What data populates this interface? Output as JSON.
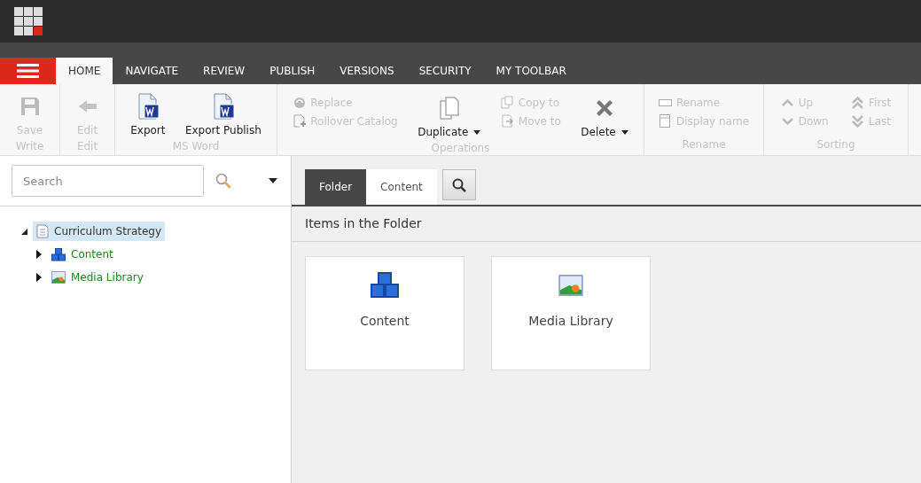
{
  "tabs": [
    {
      "label": "HOME",
      "selected": true
    },
    {
      "label": "NAVIGATE",
      "selected": false
    },
    {
      "label": "REVIEW",
      "selected": false
    },
    {
      "label": "PUBLISH",
      "selected": false
    },
    {
      "label": "VERSIONS",
      "selected": false
    },
    {
      "label": "SECURITY",
      "selected": false
    },
    {
      "label": "MY TOOLBAR",
      "selected": false
    }
  ],
  "ribbon": [
    {
      "label": "Write",
      "columns": [
        {
          "kind": "large",
          "label": "Save",
          "disabled": true
        }
      ]
    },
    {
      "label": "Edit",
      "columns": [
        {
          "kind": "large",
          "label": "Edit",
          "disabled": true
        }
      ]
    },
    {
      "label": "MS Word",
      "columns": [
        {
          "kind": "large",
          "label": "Export",
          "disabled": false
        },
        {
          "kind": "large",
          "label": "Export Publish",
          "disabled": false
        }
      ]
    },
    {
      "label": "Operations",
      "columns": [
        {
          "kind": "stack",
          "items": [
            {
              "label": "Replace",
              "disabled": true
            },
            {
              "label": "Rollover Catalog",
              "disabled": true
            }
          ]
        },
        {
          "kind": "large",
          "label": "Duplicate",
          "disabled": false,
          "dropdown": true
        },
        {
          "kind": "stack",
          "items": [
            {
              "label": "Copy to",
              "disabled": true
            },
            {
              "label": "Move to",
              "disabled": true
            }
          ]
        },
        {
          "kind": "large",
          "label": "Delete",
          "disabled": false,
          "dropdown": true
        }
      ]
    },
    {
      "label": "Rename",
      "columns": [
        {
          "kind": "stack",
          "items": [
            {
              "label": "Rename",
              "disabled": true
            },
            {
              "label": "Display name",
              "disabled": true
            }
          ]
        }
      ]
    },
    {
      "label": "Sorting",
      "columns": [
        {
          "kind": "stack",
          "items": [
            {
              "label": "Up",
              "disabled": true
            },
            {
              "label": "Down",
              "disabled": true
            }
          ]
        },
        {
          "kind": "stack",
          "items": [
            {
              "label": "First",
              "disabled": true
            },
            {
              "label": "Last",
              "disabled": true
            }
          ]
        }
      ]
    }
  ],
  "search": {
    "placeholder": "Search"
  },
  "tree": [
    {
      "label": "Curriculum Strategy",
      "expanded": true,
      "selected": true,
      "children": [
        {
          "label": "Content",
          "expanded": false,
          "selected": false
        },
        {
          "label": "Media Library",
          "expanded": false,
          "selected": false
        }
      ]
    }
  ],
  "view_tabs": [
    {
      "label": "Folder",
      "selected": true
    },
    {
      "label": "Content",
      "selected": false
    }
  ],
  "section_title": "Items in the Folder",
  "tiles": [
    {
      "label": "Content"
    },
    {
      "label": "Media Library"
    }
  ]
}
